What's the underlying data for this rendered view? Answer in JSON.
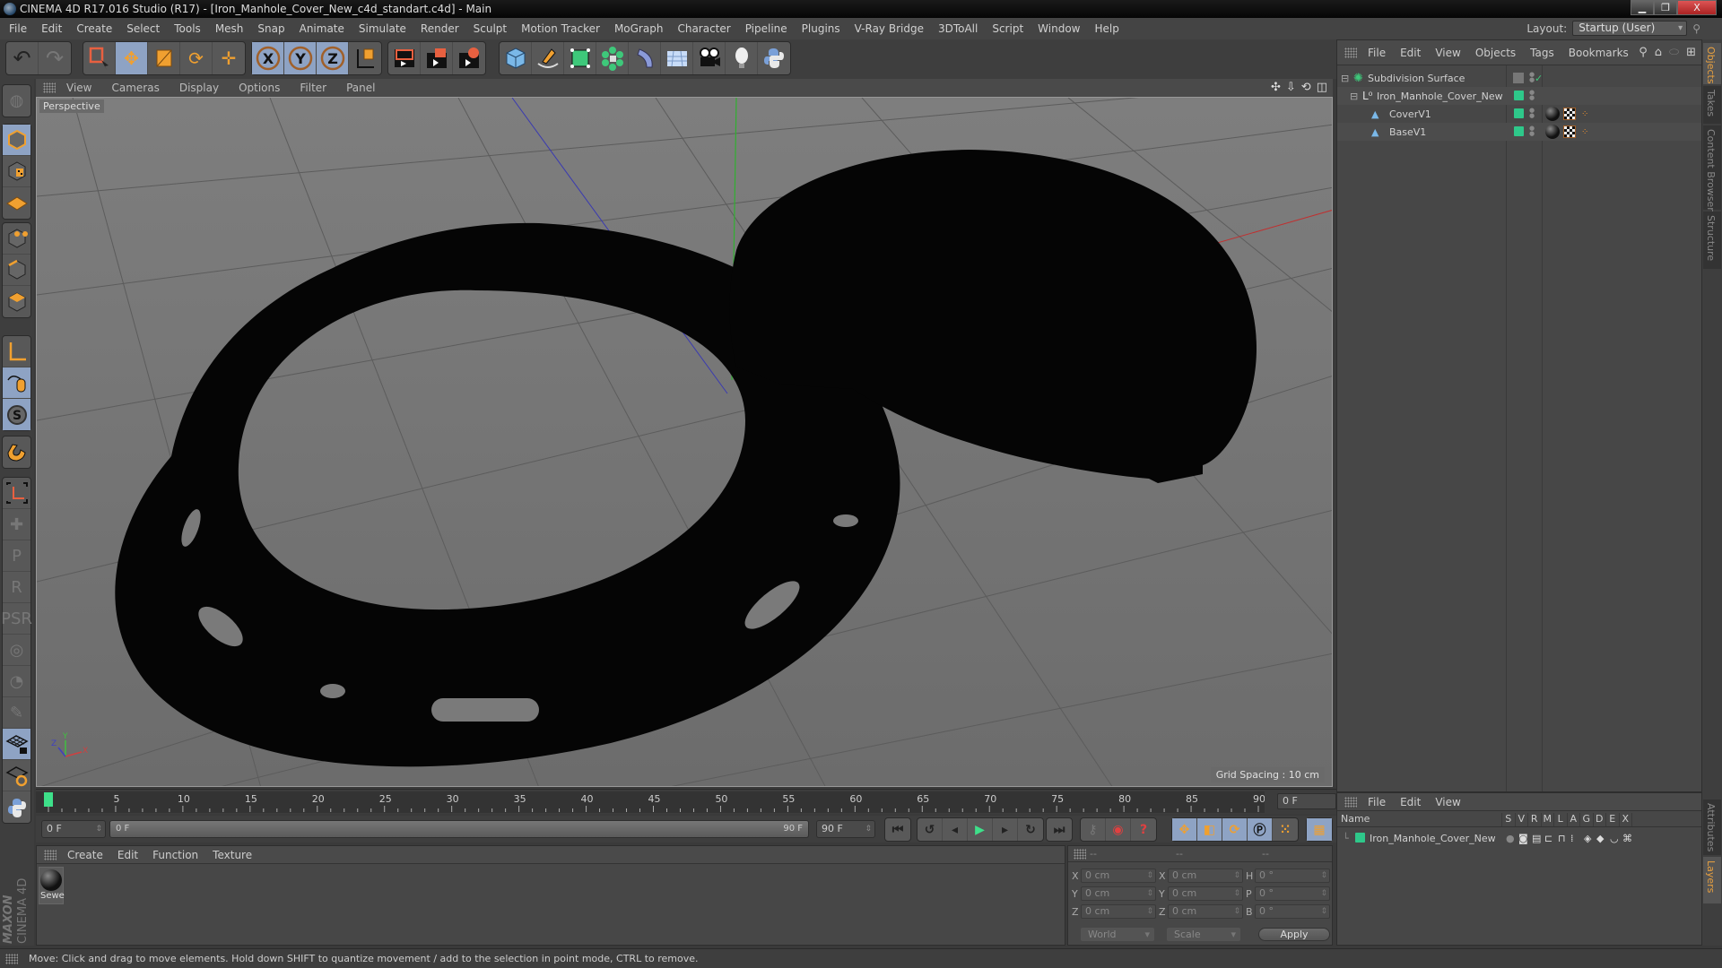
{
  "window": {
    "title": "CINEMA 4D R17.016 Studio (R17) - [Iron_Manhole_Cover_New_c4d_standart.c4d] - Main",
    "buttons": {
      "minimize": "▁",
      "maximize": "❐",
      "close": "X"
    }
  },
  "menubar": {
    "items": [
      "File",
      "Edit",
      "Create",
      "Select",
      "Tools",
      "Mesh",
      "Snap",
      "Animate",
      "Simulate",
      "Render",
      "Sculpt",
      "Motion Tracker",
      "MoGraph",
      "Character",
      "Pipeline",
      "Plugins",
      "V-Ray Bridge",
      "3DToAll",
      "Script",
      "Window",
      "Help"
    ],
    "layout_label": "Layout:",
    "layout_value": "Startup (User)"
  },
  "toolbar": {
    "undo": "undo",
    "redo": "redo",
    "tools": [
      "live-selection",
      "move",
      "scale",
      "rotate",
      "recent-tool"
    ],
    "axes": [
      "X",
      "Y",
      "Z"
    ],
    "coord_system": "world",
    "render": [
      "render-view",
      "render-picture-viewer",
      "render-settings"
    ],
    "objects": [
      "cube",
      "pen",
      "subdivision-surface",
      "cloner",
      "bend",
      "floor",
      "camera",
      "light",
      "python"
    ]
  },
  "left_toolbar": {
    "tools": [
      "make-editable",
      "model",
      "texture",
      "workplane",
      "points",
      "edges",
      "polygons",
      "axis",
      "tweak",
      "solo",
      "snap",
      "workplane-axis",
      "add-pose",
      "pose-position",
      "pose-rotation",
      "pose-psr",
      "pose-target",
      "pose-graph",
      "pose-edit",
      "lock-workplane",
      "align-workplane",
      "python"
    ],
    "brand_top": "MAXON",
    "brand_bottom": "CINEMA 4D"
  },
  "viewport": {
    "menu": [
      "View",
      "Cameras",
      "Display",
      "Options",
      "Filter",
      "Panel"
    ],
    "camera_label": "Perspective",
    "grid_spacing": "Grid Spacing : 10 cm",
    "axis_labels": {
      "x": "X",
      "y": "Y",
      "z": "Z"
    }
  },
  "timeline": {
    "ticks": [
      "0",
      "5",
      "10",
      "15",
      "20",
      "25",
      "30",
      "35",
      "40",
      "45",
      "50",
      "55",
      "60",
      "65",
      "70",
      "75",
      "80",
      "85",
      "90"
    ],
    "current_frame": "0 F",
    "start_frame": "0 F",
    "range_start": "0 F",
    "range_end": "90 F",
    "end_frame": "90 F"
  },
  "material_manager": {
    "menu": [
      "Create",
      "Edit",
      "Function",
      "Texture"
    ],
    "materials": [
      {
        "name": "Sewe"
      }
    ]
  },
  "coordinates": {
    "headers": [
      "--",
      "--",
      "--"
    ],
    "rows": [
      {
        "l1": "X",
        "v1": "0 cm",
        "l2": "X",
        "v2": "0 cm",
        "l3": "H",
        "v3": "0 °"
      },
      {
        "l1": "Y",
        "v1": "0 cm",
        "l2": "Y",
        "v2": "0 cm",
        "l3": "P",
        "v3": "0 °"
      },
      {
        "l1": "Z",
        "v1": "0 cm",
        "l2": "Z",
        "v2": "0 cm",
        "l3": "B",
        "v3": "0 °"
      }
    ],
    "space": "World",
    "mode": "Scale",
    "apply": "Apply"
  },
  "object_manager": {
    "menu": [
      "File",
      "Edit",
      "View",
      "Objects",
      "Tags",
      "Bookmarks"
    ],
    "objects": [
      {
        "name": "Subdivision Surface",
        "icon": "subdivision-surface-icon",
        "tags": []
      },
      {
        "name": "Iron_Manhole_Cover_New",
        "icon": "null-icon",
        "tags": []
      },
      {
        "name": "CoverV1",
        "icon": "polygon-icon",
        "tags": [
          "material",
          "uvw",
          "phong"
        ]
      },
      {
        "name": "BaseV1",
        "icon": "polygon-icon",
        "tags": [
          "material",
          "uvw",
          "phong"
        ]
      }
    ],
    "accent": "#2ec88a"
  },
  "layer_manager": {
    "menu": [
      "File",
      "Edit",
      "View"
    ],
    "columns": [
      "Name",
      "S",
      "V",
      "R",
      "M",
      "L",
      "A",
      "G",
      "D",
      "E",
      "X"
    ],
    "layers": [
      {
        "name": "Iron_Manhole_Cover_New",
        "color": "#2ec88a"
      }
    ]
  },
  "side_tabs": {
    "top": [
      "Objects",
      "Takes",
      "Content Browser",
      "Structure"
    ],
    "bottom": [
      "Attributes",
      "Layers"
    ]
  },
  "status": "Move: Click and drag to move elements. Hold down SHIFT to quantize movement / add to the selection in point mode, CTRL to remove."
}
